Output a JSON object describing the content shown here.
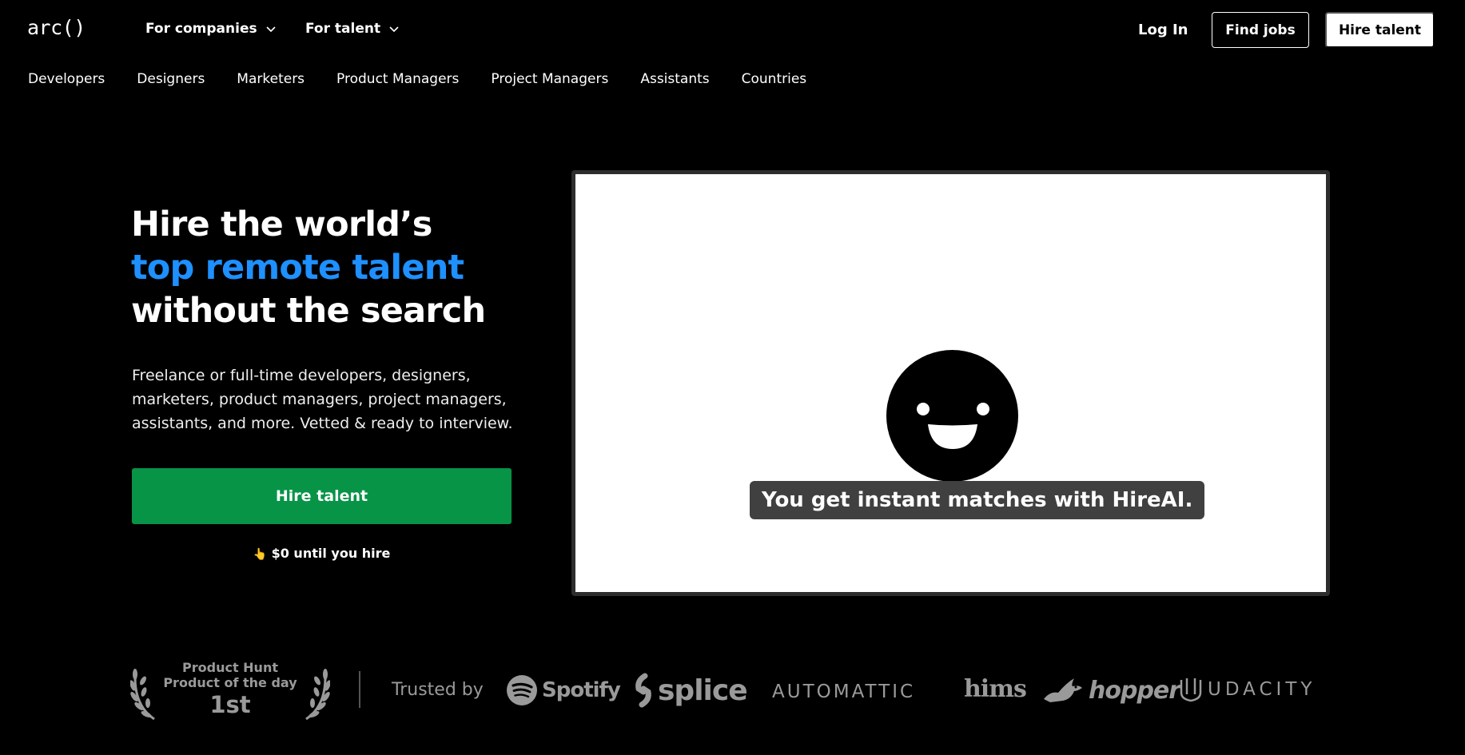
{
  "header": {
    "logo": "arc()",
    "for_companies": "For companies",
    "for_talent": "For talent",
    "login": "Log In",
    "find_jobs": "Find jobs",
    "hire_talent": "Hire talent"
  },
  "subnav": [
    "Developers",
    "Designers",
    "Marketers",
    "Product Managers",
    "Project Managers",
    "Assistants",
    "Countries"
  ],
  "hero": {
    "title_line1": "Hire the world’s",
    "title_line2": "top remote talent",
    "title_line3": "without the search",
    "subtitle": "Freelance or full-time developers, designers, marketers, product managers, project managers, assistants, and more. Vetted & ready to interview.",
    "cta": "Hire talent",
    "note_icon": "👆",
    "note": "$0 until you hire"
  },
  "video": {
    "caption": "You get instant matches with HireAI."
  },
  "trust": {
    "award_line1": "Product Hunt",
    "award_line2": "Product of the day",
    "award_rank": "1st",
    "label": "Trusted by",
    "logos": [
      "Spotify",
      "splice",
      "AUTOMATTIC",
      "hims",
      "hopper",
      "UDACITY"
    ]
  },
  "colors": {
    "accent_blue": "#1e90ff",
    "cta_green": "#079447",
    "logo_gray": "#9a9a9a"
  }
}
